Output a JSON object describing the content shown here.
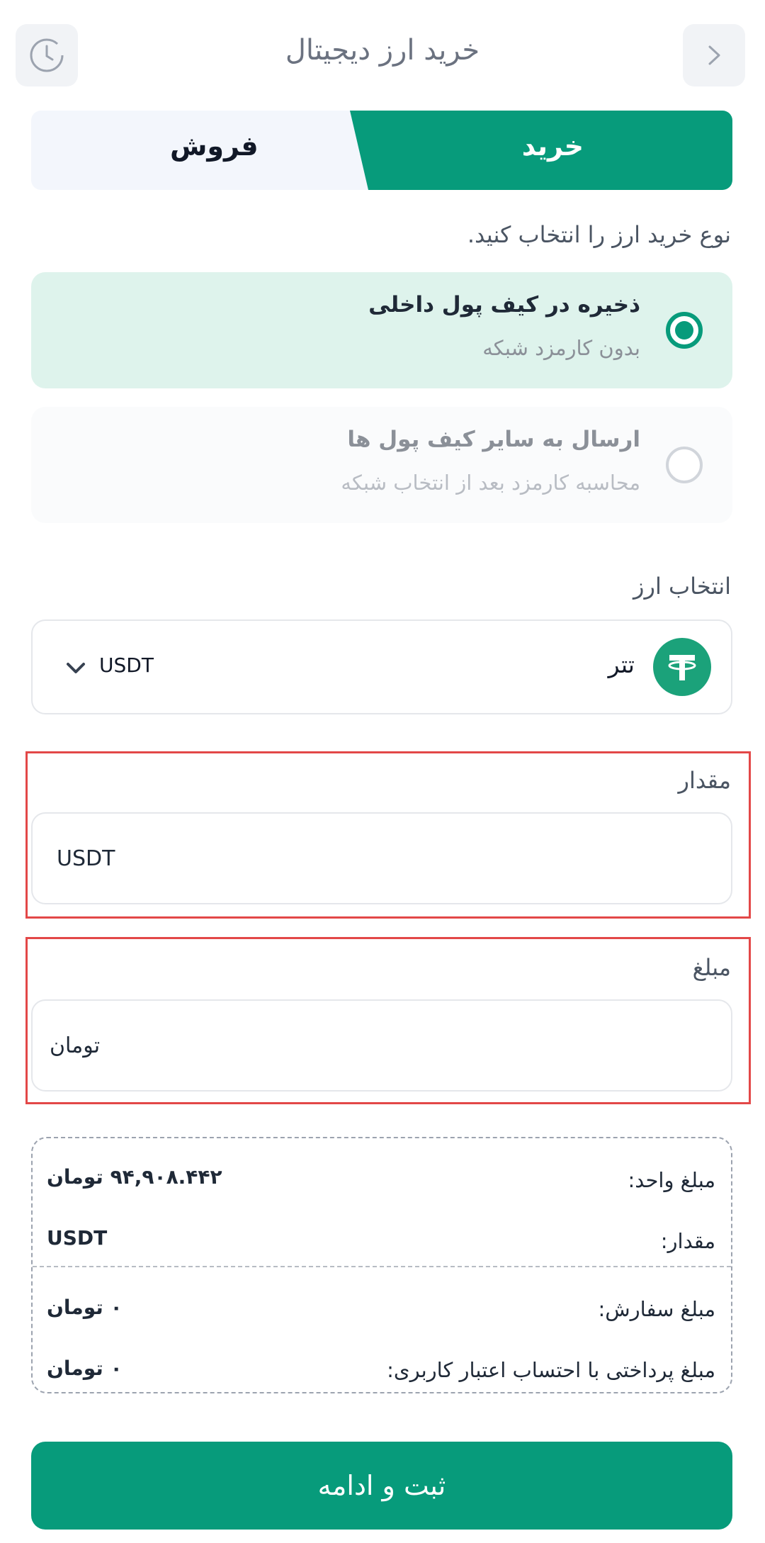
{
  "header": {
    "title": "خرید ارز دیجیتال",
    "back_icon": "chevron-right-icon",
    "history_icon": "clock-history-icon"
  },
  "tabs": [
    {
      "label": "خرید",
      "active": true
    },
    {
      "label": "فروش",
      "active": false
    }
  ],
  "purchase_type": {
    "label": "نوع خرید ارز را انتخاب کنید.",
    "options": [
      {
        "title": "ذخیره در کیف پول داخلی",
        "subtitle": "بدون کارمزد شبکه",
        "selected": true
      },
      {
        "title": "ارسال به سایر کیف پول ها",
        "subtitle": "محاسبه کارمزد بعد از انتخاب شبکه",
        "selected": false
      }
    ]
  },
  "currency": {
    "label": "انتخاب ارز",
    "name": "تتر",
    "symbol": "USDT",
    "icon": "tether-icon"
  },
  "amount": {
    "label": "مقدار",
    "placeholder": "USDT"
  },
  "price": {
    "label": "مبلغ",
    "placeholder": "تومان"
  },
  "summary": {
    "unit_price_label": "مبلغ واحد:",
    "unit_price_value": "۹۴,۹۰۸.۴۴۲ تومان",
    "quantity_label": "مقدار:",
    "quantity_value": "USDT",
    "order_amount_label": "مبلغ سفارش:",
    "order_amount_value": "۰ تومان",
    "payable_label": "مبلغ پرداختی با احتساب اعتبار کاربری:",
    "payable_value": "۰ تومان"
  },
  "submit_label": "ثبت و ادامه",
  "colors": {
    "primary": "#079b7b",
    "highlight": "#e34848",
    "selected_bg": "#def3ec"
  }
}
